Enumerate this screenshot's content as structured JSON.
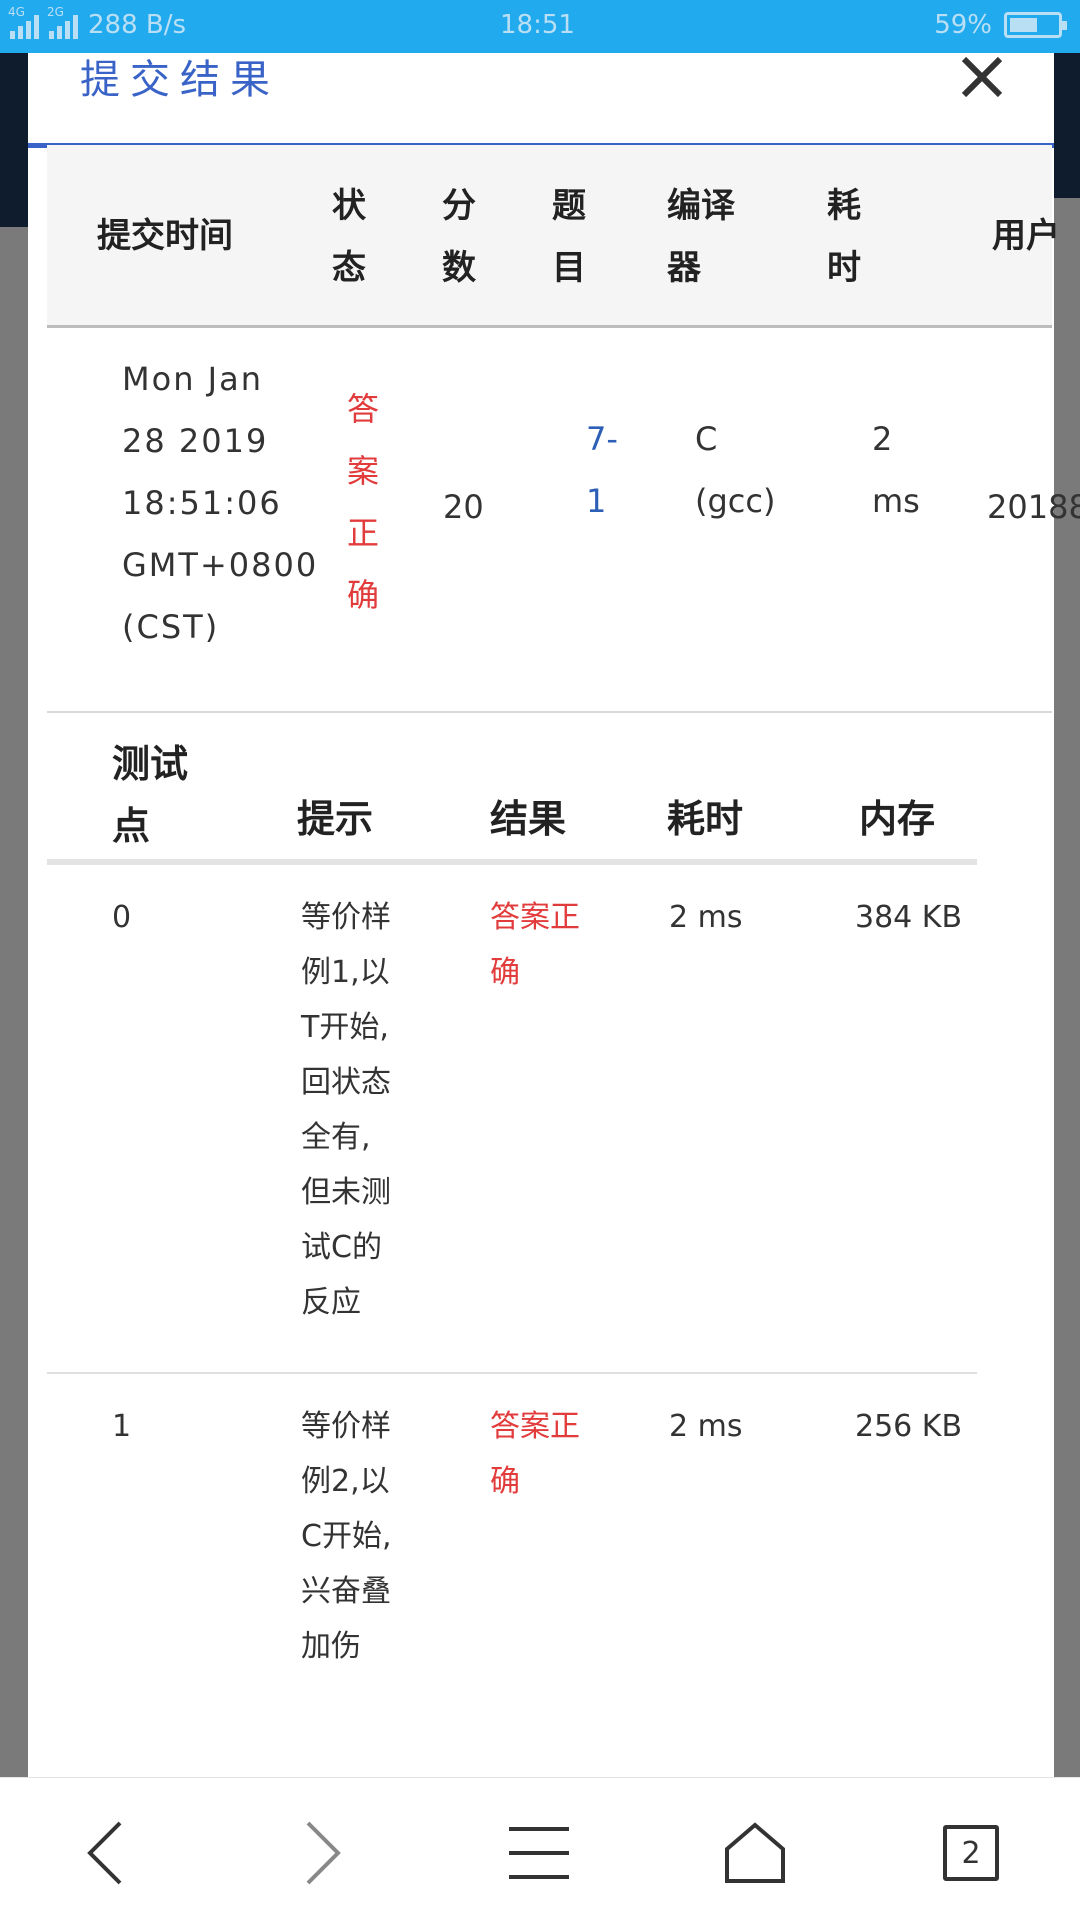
{
  "status_bar": {
    "network_4g": "4G",
    "network_2g": "2G",
    "speed": "288 B/s",
    "time": "18:51",
    "battery_percent": "59%",
    "battery_level": 0.59
  },
  "modal": {
    "title": "提交结果"
  },
  "submission": {
    "headers": {
      "time": "提交时间",
      "status": "状态",
      "score": "分数",
      "problem": "题目",
      "compiler": "编译器",
      "elapsed": "耗时",
      "user": "用户"
    },
    "row": {
      "time_l1": "Mon Jan",
      "time_l2": "28 2019",
      "time_l3": "18:51:06",
      "time_l4": "GMT+0800",
      "time_l5": "(CST)",
      "status": "答案正确",
      "score": "20",
      "problem": "7-1",
      "compiler_l1": "C",
      "compiler_l2": "(gcc)",
      "elapsed_l1": "2",
      "elapsed_l2": "ms",
      "user": "20188"
    }
  },
  "test_points": {
    "headers": {
      "id_l1": "测试",
      "id_l2": "点",
      "hint": "提示",
      "result": "结果",
      "elapsed": "耗时",
      "memory": "内存"
    },
    "rows": [
      {
        "id": "0",
        "hint_lines": [
          "等价样",
          "例1,以",
          "T开始,",
          "回状态",
          "全有,",
          "但未测",
          "试C的",
          "反应"
        ],
        "result_l1": "答案正",
        "result_l2": "确",
        "elapsed": "2 ms",
        "memory": "384 KB"
      },
      {
        "id": "1",
        "hint_lines": [
          "等价样",
          "例2,以",
          "C开始,",
          "兴奋叠",
          "加伤"
        ],
        "result_l1": "答案正",
        "result_l2": "确",
        "elapsed": "2 ms",
        "memory": "256 KB"
      }
    ]
  },
  "bottom_nav": {
    "tab_count": "2"
  }
}
